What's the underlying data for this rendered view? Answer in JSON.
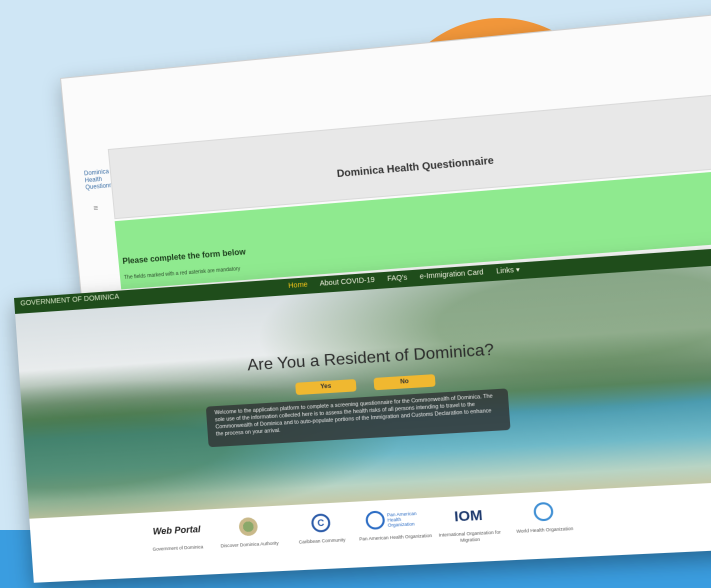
{
  "colors": {
    "sky": "#cfe6f5",
    "sun": "#f2973a",
    "band": "#3a9de0",
    "nav_green": "#1f4d1b",
    "form_green": "#8fea8f",
    "button_yellow": "#f0b830"
  },
  "questionnaire": {
    "sidebar_title": "Dominica Health Questionnaire",
    "header_title": "Dominica Health Questionnaire",
    "notice_heading": "Please complete the form below",
    "notice_subtext": "The fields marked with a red asterisk are mandatory"
  },
  "homepage": {
    "nav": {
      "logo_text": "GOVERNMENT OF DOMINICA",
      "items": [
        {
          "label": "Home"
        },
        {
          "label": "About COVID-19"
        },
        {
          "label": "FAQ's"
        },
        {
          "label": "e-Immigration Card"
        },
        {
          "label": "Links ▾"
        }
      ]
    },
    "hero": {
      "title": "Are You a Resident of Dominica?",
      "yes_label": "Yes",
      "no_label": "No",
      "info": "Welcome to the application platform to complete a screening questionnaire for the Commonwealth of Dominica. The sole use of the information collected here is to assess the health risks of all persons intending to travel to the Commonwealth of Dominica and to auto-populate portions of the Immigration and Customs Declaration to enhance the process on your arrival."
    },
    "partners": [
      {
        "logo": "Web Portal",
        "label": "Government of Dominica"
      },
      {
        "logo": "",
        "label": "Discover Dominica Authority"
      },
      {
        "logo": "C",
        "label": "Caribbean Community"
      },
      {
        "logo": "Pan American Health Organization",
        "label": "Pan American Health Organization"
      },
      {
        "logo": "IOM",
        "label": "International Organization for Migration"
      },
      {
        "logo": "",
        "label": "World Health Organization"
      }
    ]
  }
}
